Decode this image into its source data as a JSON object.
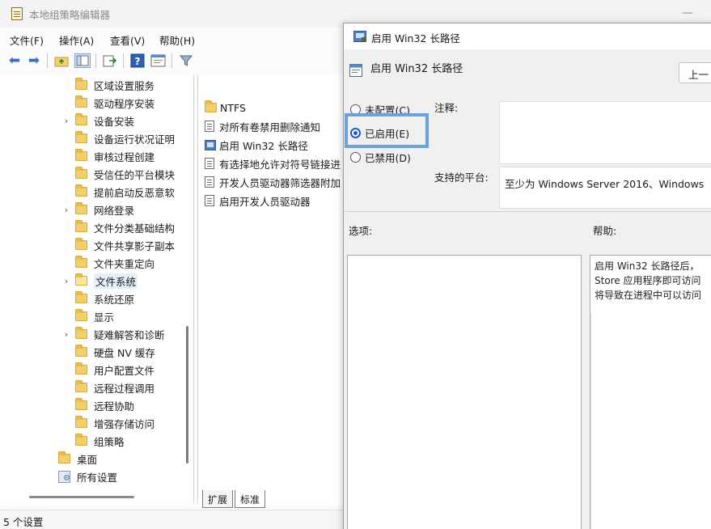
{
  "main": {
    "title": "本地组策略编辑器",
    "minimize": "—",
    "menu": [
      "文件(F)",
      "操作(A)",
      "查看(V)",
      "帮助(H)"
    ],
    "toolbar_icons": [
      "back-arrow-icon",
      "forward-arrow-icon",
      "up-folder-icon",
      "show-tree-icon",
      "export-icon",
      "help-icon",
      "properties-icon",
      "filter-icon"
    ],
    "tree": [
      {
        "label": "区域设置服务",
        "expandable": false
      },
      {
        "label": "驱动程序安装",
        "expandable": false
      },
      {
        "label": "设备安装",
        "expandable": true
      },
      {
        "label": "设备运行状况证明",
        "expandable": false
      },
      {
        "label": "审核过程创建",
        "expandable": false
      },
      {
        "label": "受信任的平台模块",
        "expandable": false
      },
      {
        "label": "提前启动反恶意软",
        "expandable": false
      },
      {
        "label": "网络登录",
        "expandable": true
      },
      {
        "label": "文件分类基础结构",
        "expandable": false
      },
      {
        "label": "文件共享影子副本",
        "expandable": false
      },
      {
        "label": "文件夹重定向",
        "expandable": false
      },
      {
        "label": "文件系统",
        "expandable": true,
        "selected": true
      },
      {
        "label": "系统还原",
        "expandable": false
      },
      {
        "label": "显示",
        "expandable": false
      },
      {
        "label": "疑难解答和诊断",
        "expandable": true
      },
      {
        "label": "硬盘 NV 缓存",
        "expandable": false
      },
      {
        "label": "用户配置文件",
        "expandable": false
      },
      {
        "label": "远程过程调用",
        "expandable": false
      },
      {
        "label": "远程协助",
        "expandable": false
      },
      {
        "label": "增强存储访问",
        "expandable": false
      },
      {
        "label": "组策略",
        "expandable": false
      }
    ],
    "tree_root_items": [
      {
        "label": "桌面",
        "icon": "folder-icon"
      },
      {
        "label": "所有设置",
        "icon": "settings-icon"
      }
    ],
    "list": [
      {
        "label": "NTFS",
        "icon": "folder-icon"
      },
      {
        "label": "对所有卷禁用删除通知",
        "icon": "doc-icon"
      },
      {
        "label": "启用 Win32 长路径",
        "icon": "policy-icon"
      },
      {
        "label": "有选择地允许对符号链接进",
        "icon": "doc-icon"
      },
      {
        "label": "开发人员驱动器筛选器附加",
        "icon": "doc-icon"
      },
      {
        "label": "启用开发人员驱动器",
        "icon": "doc-icon"
      }
    ],
    "tabs": [
      "扩展",
      "标准"
    ],
    "status": "5 个设置"
  },
  "dialog": {
    "title": "启用 Win32 长路径",
    "header": "启用 Win32 长路径",
    "prev_button": "上一",
    "radios": [
      {
        "label": "未配置(C)",
        "checked": false
      },
      {
        "label": "已启用(E)",
        "checked": true
      },
      {
        "label": "已禁用(D)",
        "checked": false
      }
    ],
    "comment_label": "注释:",
    "platform_label": "支持的平台:",
    "platform_value": "至少为 Windows Server 2016、Windows",
    "options_label": "选项:",
    "help_label": "帮助:",
    "help_lines": [
      "启用 Win32 长路径后，",
      "Store 应用程序即可访问",
      "将导致在进程中可以访问"
    ],
    "accent_color": "#6aa3d8"
  }
}
